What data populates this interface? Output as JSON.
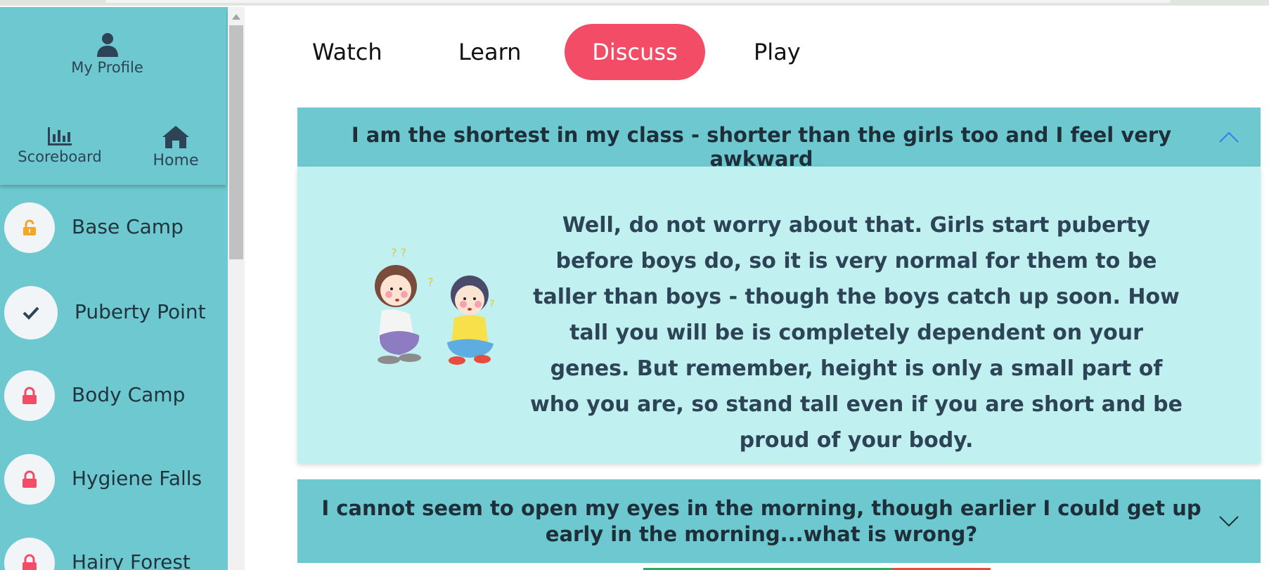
{
  "sidebar": {
    "profile_label": "My Profile",
    "scoreboard_label": "Scoreboard",
    "home_label": "Home",
    "levels": [
      {
        "label": "Base Camp",
        "icon": "unlock-icon",
        "status": "unlocked"
      },
      {
        "label": "Puberty Point",
        "icon": "check-icon",
        "status": "completed"
      },
      {
        "label": "Body Camp",
        "icon": "lock-icon",
        "status": "locked"
      },
      {
        "label": "Hygiene Falls",
        "icon": "lock-icon",
        "status": "locked"
      },
      {
        "label": "Hairy Forest",
        "icon": "lock-icon",
        "status": "locked"
      }
    ]
  },
  "tabs": [
    {
      "label": "Watch",
      "active": false
    },
    {
      "label": "Learn",
      "active": false
    },
    {
      "label": "Discuss",
      "active": true
    },
    {
      "label": "Play",
      "active": false
    }
  ],
  "accordion": [
    {
      "question": "I am the shortest in my class - shorter than the girls too and I feel very awkward",
      "expanded": true,
      "answer": "Well, do not worry about that. Girls start puberty before boys do, so it is very normal for them to be taller than boys - though the boys catch up soon. How tall you will be is completely dependent on your genes. But remember, height is only a small part of who you are, so stand tall even if you are short and be proud of your body."
    },
    {
      "question": "I cannot seem to open my eyes in the morning, though earlier I could get up early in the morning...what is wrong?",
      "expanded": false
    }
  ],
  "colors": {
    "sidebar_bg": "#6dc9cf",
    "active_tab": "#f34c66",
    "lock": "#f34c66",
    "unlock": "#f5a623",
    "answer_bg": "#c0f0ef",
    "text_dark": "#2d4356"
  }
}
